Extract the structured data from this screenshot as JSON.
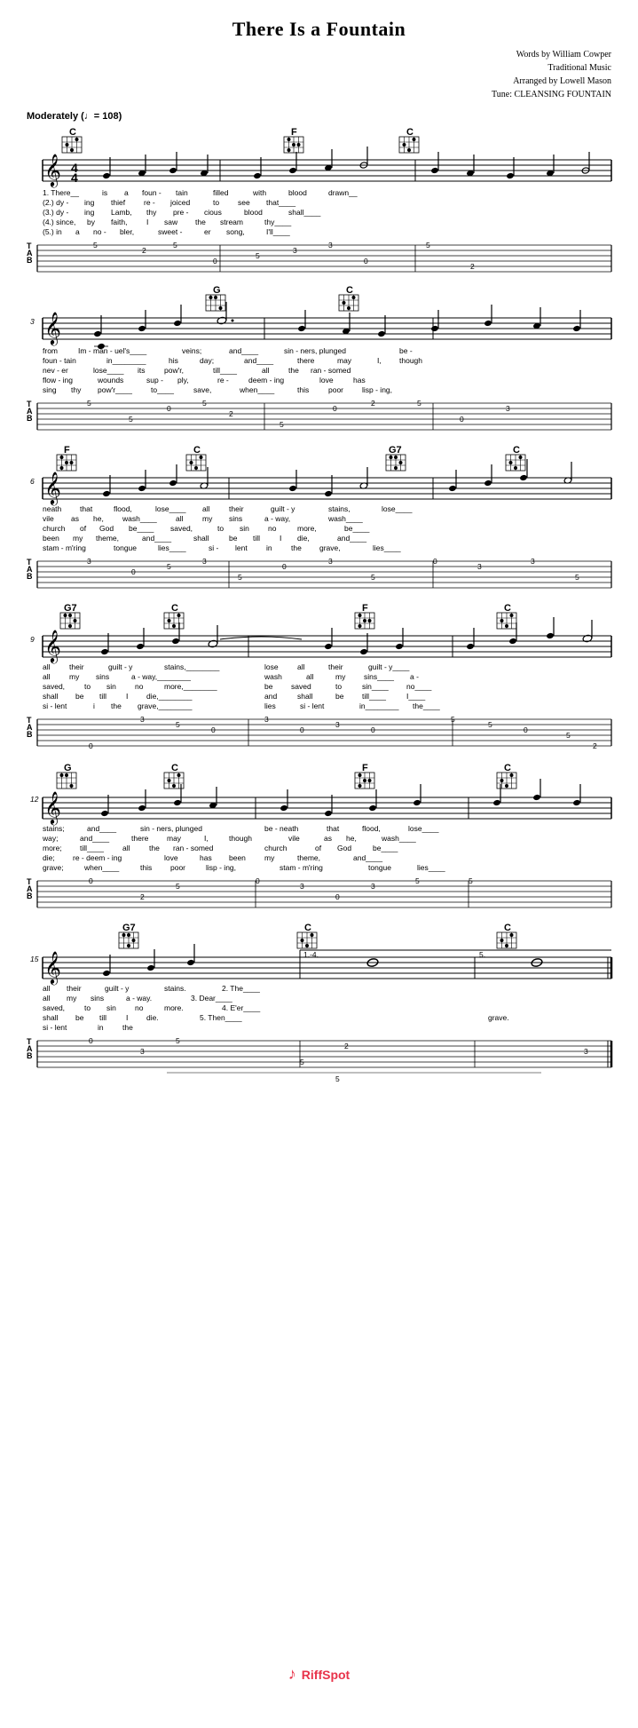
{
  "title": "There Is a Fountain",
  "credits": {
    "words": "Words by William Cowper",
    "music": "Traditional Music",
    "arranged": "Arranged by Lowell Mason",
    "tune": "Tune: CLEANSING FOUNTAIN"
  },
  "tempo": {
    "label": "Moderately",
    "bpm": "♩= 108"
  },
  "watermark": {
    "text": "RiffSpot",
    "icon": "♪"
  },
  "sections": [
    {
      "id": 1,
      "chords": [
        "C",
        "F",
        "C"
      ],
      "lyrics_lines": [
        "1. There__    is    a    foun  -  tain    filled    with    blood    drawn__",
        "(2.) dy  -  ing    thief    re  -  joiced    to    see    that____",
        "(3.) dy  -  ing    Lamb,    thy    pre  -  cious    blood    shall____",
        "(4.) since,    by    faith,    I    saw    the    stream    thy____",
        "(5.) in    a    no  -  bler,    sweet  -  er    song,    I'll____"
      ]
    },
    {
      "id": 2,
      "chords": [
        "G",
        "C"
      ],
      "lyrics_lines": [
        "from    Im - man - uel's____    veins;    and____    sin  -  ners, plunged    be -",
        "foun  -  tain    in________    his    day;    and____    there    may    I,    though",
        "nev  -  er    lose____    its    pow'r,    till____    all    the    ran - somed",
        "flow  -  ing    wounds    sup  -  ply,    re  -  deem  -  ing    love    has",
        "sing    thy    pow'r____    to____    save,    when____    this    poor    lisp - ing,"
      ]
    },
    {
      "id": 3,
      "chords": [
        "F",
        "C",
        "G7",
        "C"
      ],
      "lyrics_lines": [
        "neath    that    flood,    lose____    all    their    guilt  -  y    stains,    lose____",
        "vile    as    he,    wash____    all    my    sins    a  -  way,    wash____",
        "church    of    God    be____    saved,    to    sin    no    more,    be____",
        "been    my    theme,    and____    shall    be    till    I    die,    and____",
        "stam  -  m'ring    tongue    lies____    si  -  lent    in    the    grave,    lies____"
      ]
    },
    {
      "id": 4,
      "chords": [
        "G7",
        "C",
        "F",
        "C"
      ],
      "lyrics_lines": [
        "all    their    guilt  -  y    stains,________    lose    all    their    guilt  -  y____",
        "all    my    sins    a  -  way,________    wash    all    my    sins____    a  -",
        "saved,    to    sin    no    more,________    be    saved    to    sin____    no____",
        "shall    be    till    I    die,________    and    shall    be    till____    I____",
        "si  -  lent    i    the    grave,________    lies    si  -  lent    in________    the____"
      ]
    },
    {
      "id": 5,
      "chords": [
        "G",
        "C",
        "F",
        "C"
      ],
      "lyrics_lines": [
        "stains;    and____    sin  -  ners, plunged    be  -  neath    that    flood,    lose____",
        "way;    and____    there    may    I,    though    vile    as    he,    wash____",
        "more;    till____    all    the    ran - somed    church    of    God    be____",
        "die;    re  -  deem  -  ing    love    has    been    my    theme,    and____",
        "grave;    when____    this    poor    lisp  -  ing,    stam  -  m'ring    tongue    lies____"
      ]
    },
    {
      "id": 6,
      "chords": [
        "G7",
        "C",
        "C"
      ],
      "lyrics_lines": [
        "all    their    guilt  -  y    stains.    2. The____",
        "all    my    sins    a  -  way.    3. Dear____",
        "saved,    to    sin    no    more.    4. E'er____",
        "shall    be    till    I    die.    5. Then____",
        "si  -  lent    in    the                    grave."
      ],
      "endings": [
        "1.-4.",
        "5."
      ]
    }
  ]
}
